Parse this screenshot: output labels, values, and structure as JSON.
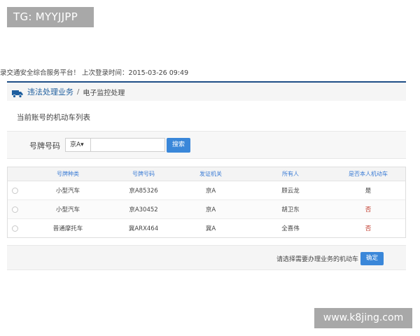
{
  "overlay": {
    "tg_badge": "TG: MYYJJPP",
    "site_badge": "www.k8jing.com"
  },
  "header": {
    "welcome_text": "录交通安全综合服务平台！ 上次登录时间：2015-03-26 09:49"
  },
  "breadcrumb": {
    "main": "违法处理业务",
    "separator": "/",
    "sub": "电子监控处理"
  },
  "section": {
    "title": "当前账号的机动车列表"
  },
  "search": {
    "label": "号牌号码",
    "province": "京A▾",
    "input_value": "",
    "button": "搜索"
  },
  "table": {
    "headers": [
      "号牌种类",
      "号牌号码",
      "发证机关",
      "所有人",
      "是否本人机动车"
    ],
    "rows": [
      [
        "小型汽车",
        "京A85326",
        "京A",
        "顾云龙",
        "是"
      ],
      [
        "小型汽车",
        "京A30452",
        "京A",
        "胡卫东",
        "否"
      ],
      [
        "普通摩托车",
        "冀ARX464",
        "冀A",
        "全喜伟",
        "否"
      ]
    ]
  },
  "footer": {
    "prompt": "请选择需要办理业务的机动车",
    "confirm": "确定"
  },
  "colors": {
    "accent": "#3a87d9",
    "header_text": "#3a7bd5",
    "border_top": "#1f4e86",
    "status_no": "#c0392b"
  },
  "icons": {
    "breadcrumb": "truck-icon"
  }
}
